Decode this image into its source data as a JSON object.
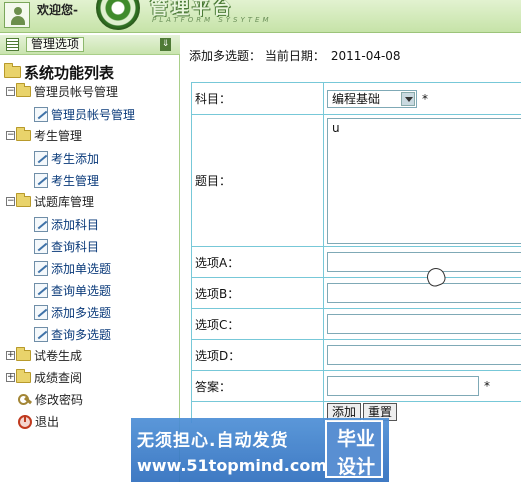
{
  "header": {
    "welcome": "欢迎您-",
    "logo_title": "管理平台",
    "logo_sub": "PLATFORM SYSYTEM"
  },
  "sidebar": {
    "head_label": "管理选项",
    "collapse_glyph": "⇓",
    "root": "系统功能列表",
    "items": [
      {
        "label": "管理员帐号管理"
      },
      {
        "label": "管理员帐号管理"
      },
      {
        "label": "考生管理"
      },
      {
        "label": "考生添加"
      },
      {
        "label": "考生管理"
      },
      {
        "label": "试题库管理"
      },
      {
        "label": "添加科目"
      },
      {
        "label": "查询科目"
      },
      {
        "label": "添加单选题"
      },
      {
        "label": "查询单选题"
      },
      {
        "label": "添加多选题"
      },
      {
        "label": "查询多选题"
      },
      {
        "label": "试卷生成"
      },
      {
        "label": "成绩查阅"
      },
      {
        "label": "修改密码"
      },
      {
        "label": "退出"
      }
    ]
  },
  "main": {
    "crumb": "添加多选题：  当前日期：",
    "date": "2011-04-08",
    "subject_label": "科目：",
    "subject_value": "编程基础",
    "required_mark": "*",
    "question_label": "题目：",
    "question_value": "u",
    "optA_label": "选项A：",
    "optB_label": "选项B：",
    "optC_label": "选项C：",
    "optD_label": "选项D：",
    "answer_label": "答案：",
    "add_button": "添加",
    "reset_button": "重置"
  },
  "watermark": {
    "line1": "无须担心.自动发货",
    "line2": "www.51topmind.com",
    "box_top": "毕业",
    "box_bottom": "设计"
  }
}
